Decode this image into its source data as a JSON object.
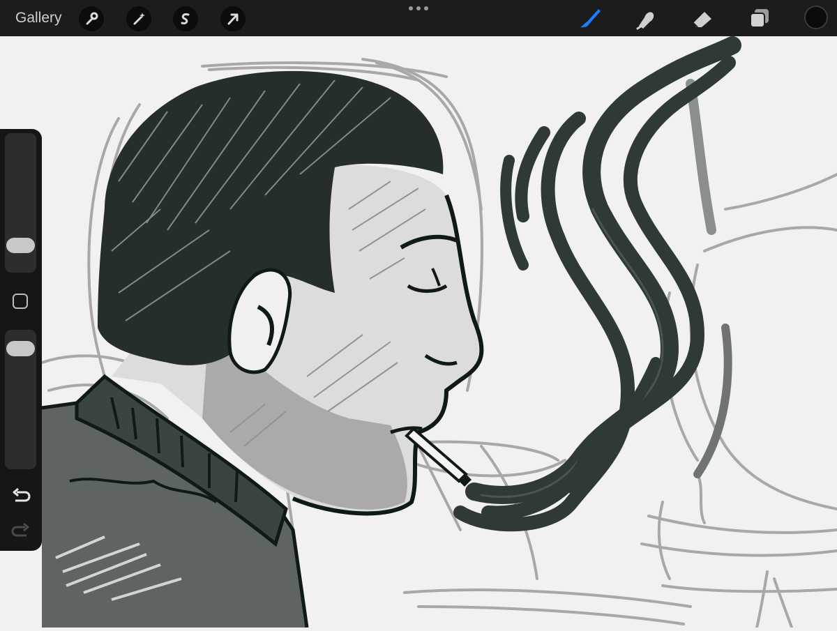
{
  "topbar": {
    "gallery_label": "Gallery",
    "left_tools": [
      {
        "name": "actions",
        "icon": "wrench-icon"
      },
      {
        "name": "adjustments",
        "icon": "magic-wand-icon"
      },
      {
        "name": "selection",
        "icon": "selection-s-icon"
      },
      {
        "name": "transform",
        "icon": "arrow-cursor-icon"
      }
    ],
    "more_icon": "more-dots-icon",
    "right_tools": [
      {
        "name": "brush",
        "icon": "brush-icon",
        "active": true
      },
      {
        "name": "smudge",
        "icon": "smudge-finger-icon",
        "active": false
      },
      {
        "name": "eraser",
        "icon": "eraser-icon",
        "active": false
      },
      {
        "name": "layers",
        "icon": "layers-icon",
        "active": false
      }
    ],
    "current_color": "#0b0b0b"
  },
  "sidebar": {
    "brush_size_level": 0.15,
    "opacity_level": 0.92,
    "undo_icon": "undo-icon",
    "redo_icon": "redo-icon",
    "modify_icon": "square-modify-icon"
  },
  "colors": {
    "toolbar_bg": "#1c1c1c",
    "accent_blue": "#1a7cff",
    "canvas_bg": "#f1f1f1",
    "ink": "#0f1a14",
    "smoke": "#2f3a36"
  }
}
